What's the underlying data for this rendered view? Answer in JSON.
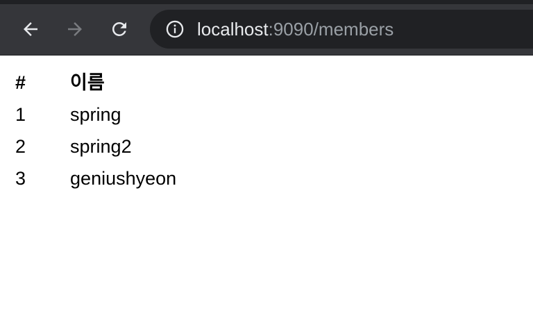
{
  "browser": {
    "url_host": "localhost",
    "url_path": ":9090/members",
    "icons": {
      "back": "arrow-left-icon",
      "forward": "arrow-right-icon",
      "reload": "reload-icon",
      "site_info": "info-icon"
    }
  },
  "table": {
    "headers": [
      "#",
      "이름"
    ],
    "rows": [
      {
        "id": "1",
        "name": "spring"
      },
      {
        "id": "2",
        "name": "spring2"
      },
      {
        "id": "3",
        "name": "geniushyeon"
      }
    ]
  }
}
